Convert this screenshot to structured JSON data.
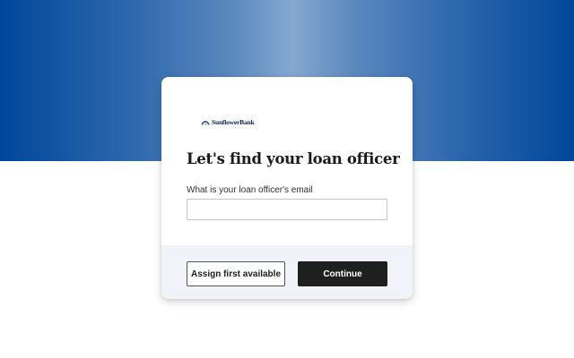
{
  "brand": {
    "name": "SunflowerBank",
    "hero_gradient": [
      "#00479a",
      "#86a8cf",
      "#00479a"
    ],
    "logo_color": "#0f2a55",
    "icon": "sunflower-logo-icon"
  },
  "form": {
    "title": "Let's find your loan officer",
    "email_label": "What is your loan officer's email",
    "email_value": "",
    "email_placeholder": ""
  },
  "actions": {
    "secondary_label": "Assign first available",
    "primary_label": "Continue",
    "primary_color": "#1f1f1f"
  }
}
